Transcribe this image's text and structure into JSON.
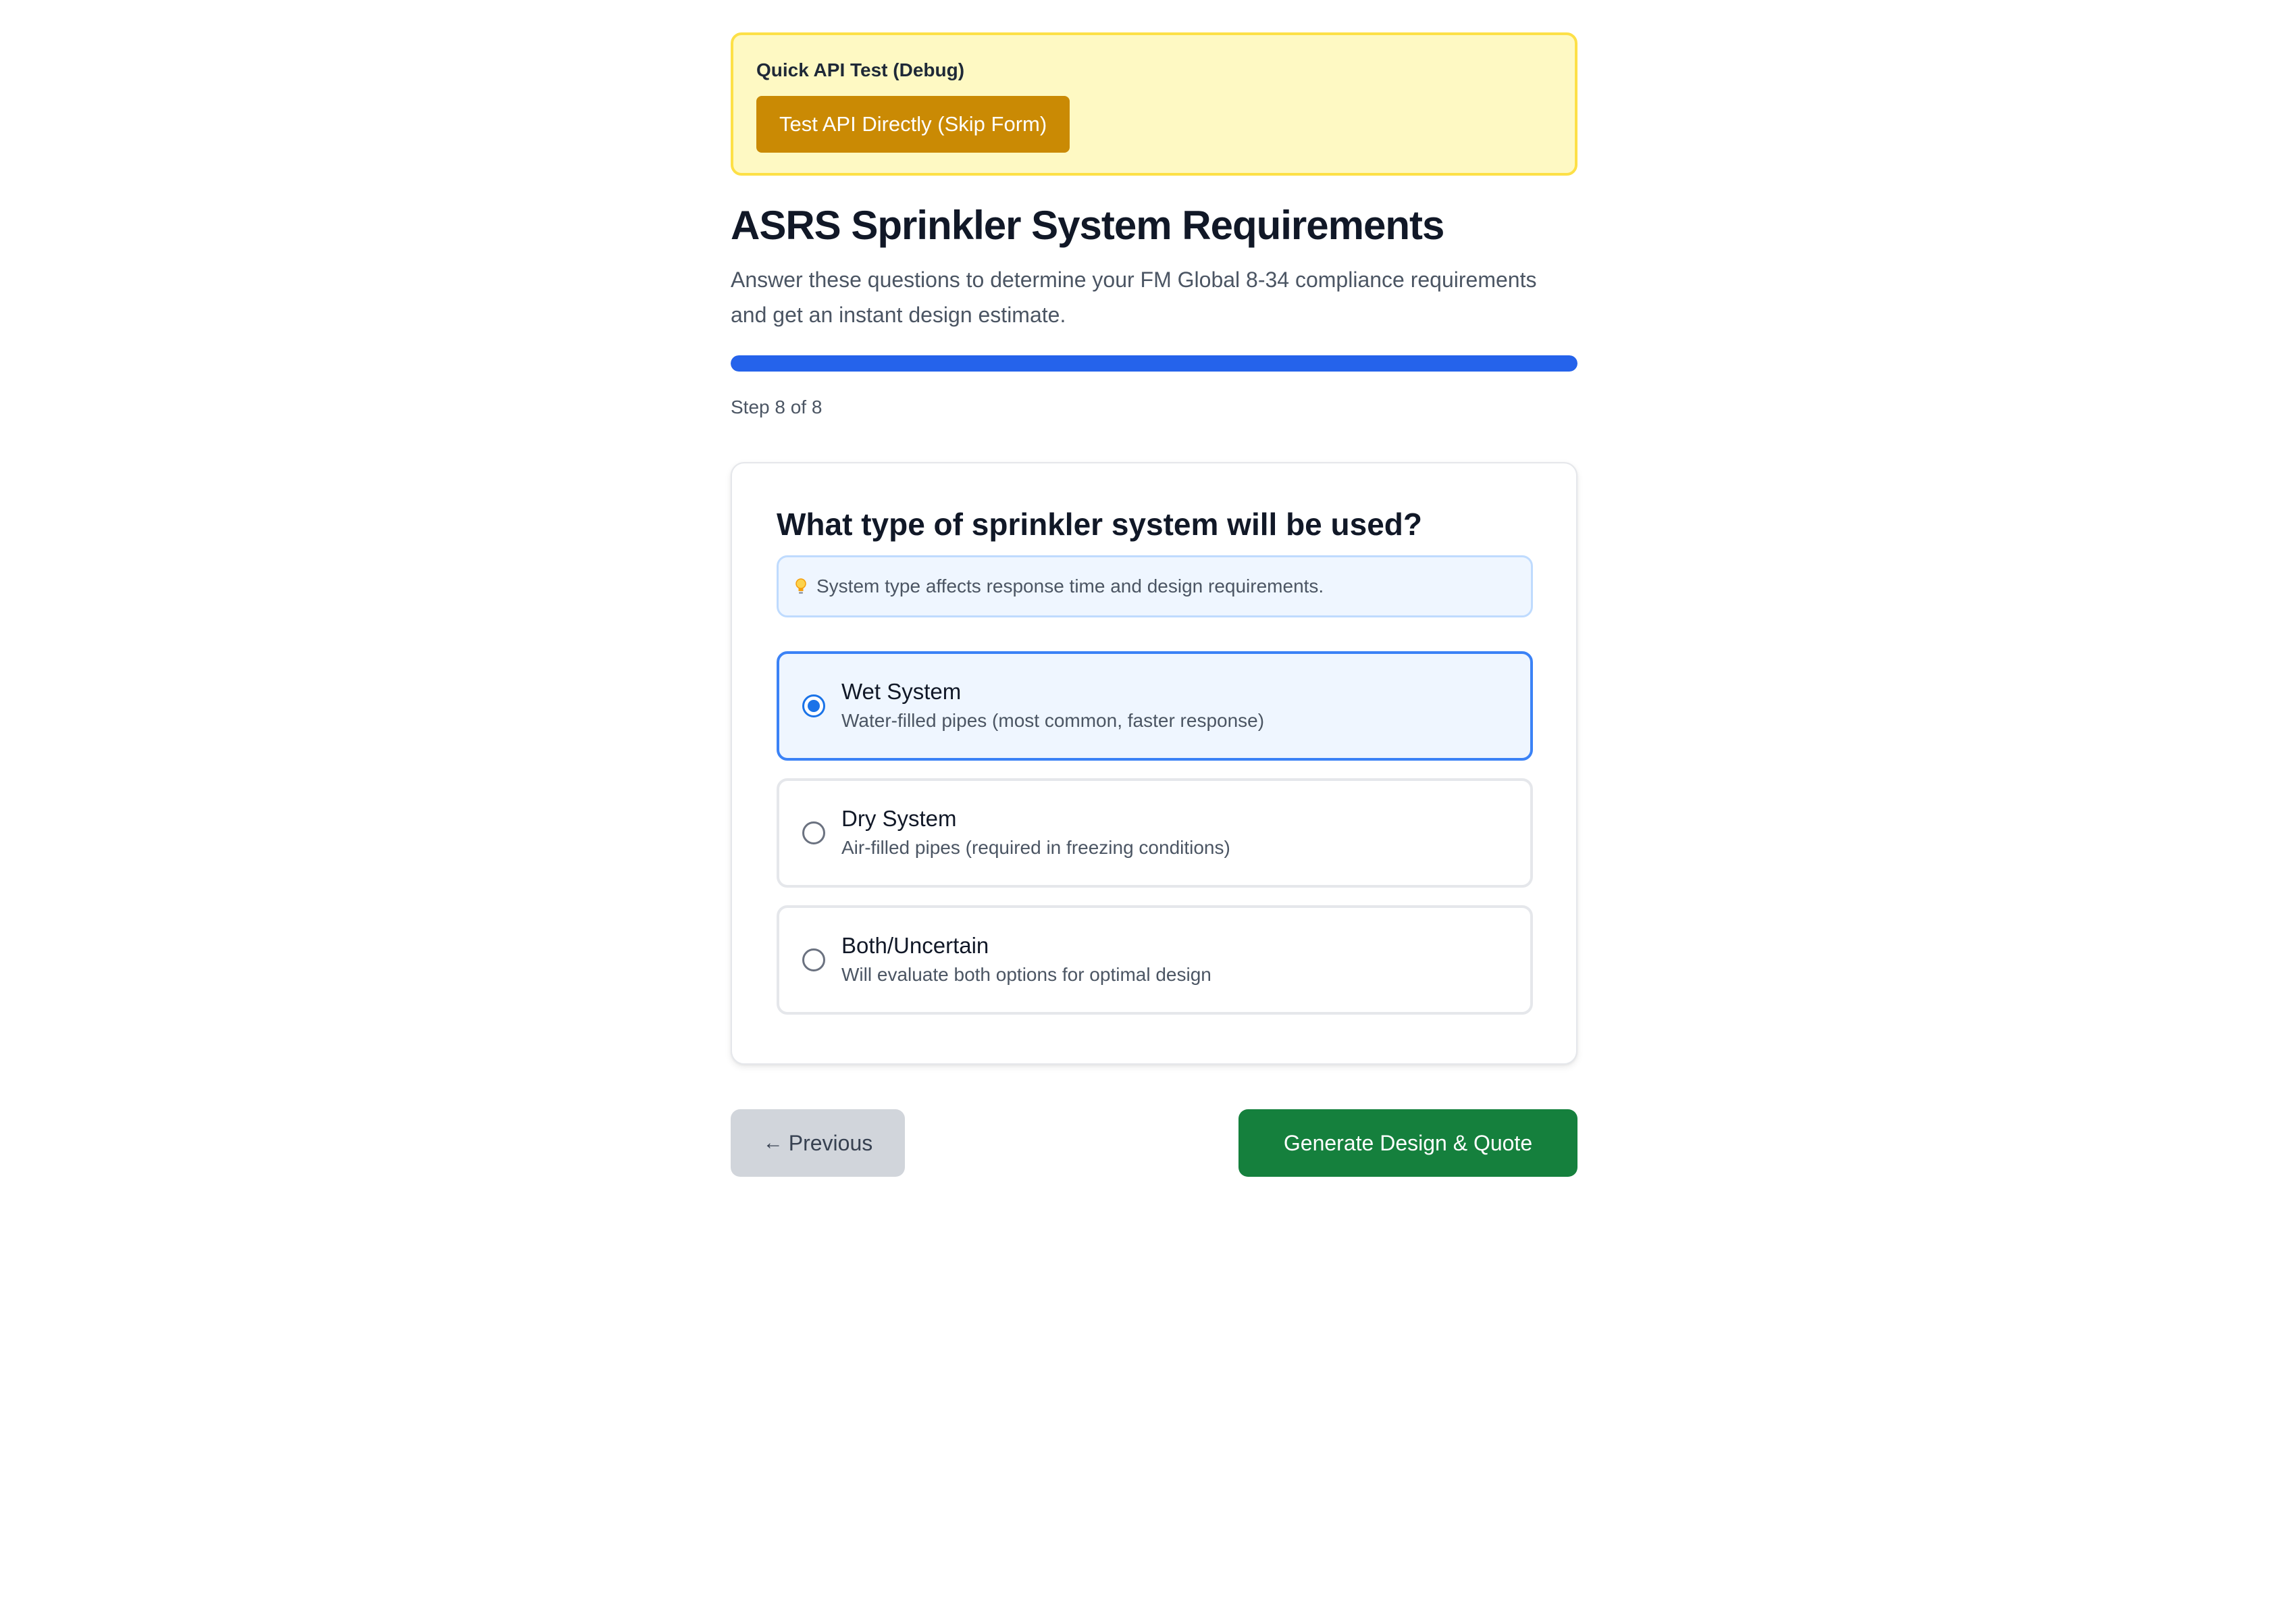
{
  "debug": {
    "title": "Quick API Test (Debug)",
    "button_label": "Test API Directly (Skip Form)"
  },
  "header": {
    "title": "ASRS Sprinkler System Requirements",
    "description": "Answer these questions to determine your FM Global 8-34 compliance requirements and get an instant design estimate."
  },
  "progress": {
    "current_step": 8,
    "total_steps": 8,
    "fraction": 1.0,
    "step_text": "Step 8 of 8",
    "color": "#2563eb"
  },
  "question": {
    "title": "What type of sprinkler system will be used?",
    "hint_icon": "lightbulb-icon",
    "hint": "System type affects response time and design requirements.",
    "options": [
      {
        "label": "Wet System",
        "description": "Water-filled pipes (most common, faster response)",
        "selected": true
      },
      {
        "label": "Dry System",
        "description": "Air-filled pipes (required in freezing conditions)",
        "selected": false
      },
      {
        "label": "Both/Uncertain",
        "description": "Will evaluate both options for optimal design",
        "selected": false
      }
    ]
  },
  "nav": {
    "previous_icon": "arrow-left-icon",
    "previous_label": "Previous",
    "generate_label": "Generate Design & Quote"
  },
  "colors": {
    "debug_bg": "#fef9c3",
    "debug_border": "#fde047",
    "debug_button": "#ca8a04",
    "accent": "#2563eb",
    "selected_border": "#3b82f6",
    "generate_button": "#15803d"
  }
}
